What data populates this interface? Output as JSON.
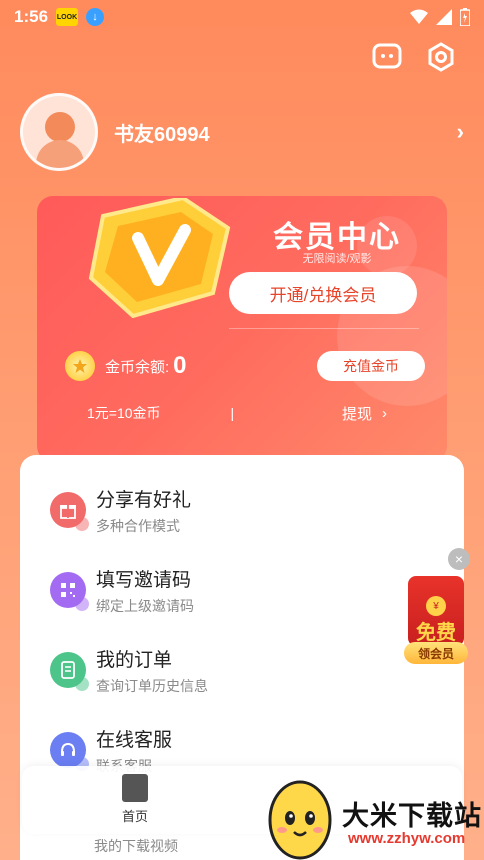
{
  "status_bar": {
    "time": "1:56",
    "app_badge": "LOOK"
  },
  "top_icons": [
    "message-icon",
    "settings-icon"
  ],
  "profile": {
    "name": "书友60994"
  },
  "vip_card": {
    "title": "会员中心",
    "subtitle": "无限阅读/观影",
    "open_button": "开通/兑换会员",
    "coin_label": "金币余额:",
    "coin_value": "0",
    "recharge_button": "充值金币",
    "rate_text": "1元=10金币",
    "separator": "|",
    "withdraw_label": "提现",
    "withdraw_arrow": "›"
  },
  "list": [
    {
      "title": "分享有好礼",
      "sub": "多种合作模式",
      "icon": "gift-icon",
      "color": "#f26b6b"
    },
    {
      "title": "填写邀请码",
      "sub": "绑定上级邀请码",
      "icon": "qr-code-icon",
      "color": "#a36bf2"
    },
    {
      "title": "我的订单",
      "sub": "查询订单历史信息",
      "icon": "order-icon",
      "color": "#4cc48a"
    },
    {
      "title": "在线客服",
      "sub": "联系客服",
      "icon": "headset-icon",
      "color": "#6b7ef2"
    }
  ],
  "peek_item_sub": "我的下载视频",
  "float_promo": {
    "close": "×",
    "coin": "¥",
    "free": "免费",
    "label": "领会员"
  },
  "tabbar": {
    "home_label": "首页"
  },
  "watermark": {
    "text": "大米下载站",
    "url": "www.zzhyw.com"
  },
  "colors": {
    "accent": "#ff6b5e",
    "button_text": "#e8442a"
  }
}
